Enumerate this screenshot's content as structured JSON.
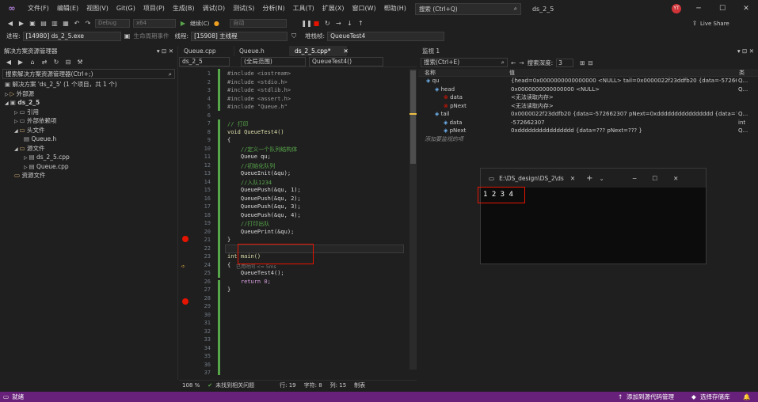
{
  "menu": [
    "文件(F)",
    "编辑(E)",
    "视图(V)",
    "Git(G)",
    "项目(P)",
    "生成(B)",
    "调试(D)",
    "测试(S)",
    "分析(N)",
    "工具(T)",
    "扩展(X)",
    "窗口(W)",
    "帮助(H)"
  ],
  "search": {
    "placeholder": "搜索 (Ctrl+Q)"
  },
  "project_title": "ds_2_5",
  "avatar": "YT",
  "live_share": "Live Share",
  "toolbar1": {
    "config": "Debug",
    "platform": "x64",
    "continue": "继续(C)",
    "frame": "自动"
  },
  "toolbar2": {
    "process_label": "进程:",
    "process": "[14980] ds_2_5.exe",
    "lifecycle": "生命周期事件",
    "thread_label": "线程:",
    "thread": "[15908] 主线程",
    "stack_label": "堆栈帧:",
    "stack": "QueueTest4"
  },
  "solution": {
    "title": "解决方案资源管理器",
    "search": "搜索解决方案资源管理器(Ctrl+;)",
    "items": [
      {
        "t": "解决方案 'ds_2_5' (1 个项目，共 1 个)",
        "lvl": 0
      },
      {
        "t": "外部源",
        "lvl": 0
      },
      {
        "t": "ds_2_5",
        "lvl": 0
      },
      {
        "t": "引用",
        "lvl": 1
      },
      {
        "t": "外部依赖项",
        "lvl": 1
      },
      {
        "t": "头文件",
        "lvl": 1
      },
      {
        "t": "Queue.h",
        "lvl": 2
      },
      {
        "t": "源文件",
        "lvl": 1
      },
      {
        "t": "ds_2_5.cpp",
        "lvl": 2
      },
      {
        "t": "Queue.cpp",
        "lvl": 2
      },
      {
        "t": "资源文件",
        "lvl": 1
      }
    ]
  },
  "editor": {
    "tabs": [
      "Queue.cpp",
      "Queue.h",
      "ds_2_5.cpp*"
    ],
    "nav_project": "ds_2_5",
    "nav_scope": "(全局范围)",
    "nav_func": "QueueTest4()",
    "lines": [
      {
        "n": "1",
        "c": "#include <iostream>"
      },
      {
        "n": "2",
        "c": "#include <stdio.h>"
      },
      {
        "n": "3",
        "c": "#include <stdlib.h>"
      },
      {
        "n": "4",
        "c": "#include <assert.h>"
      },
      {
        "n": "5",
        "c": "#include \"Queue.h\""
      },
      {
        "n": "6",
        "c": ""
      },
      {
        "n": "7",
        "c": "// 打印"
      },
      {
        "n": "8",
        "c": "void QueueTest4()"
      },
      {
        "n": "9",
        "c": "{"
      },
      {
        "n": "10",
        "c": "    //定义一个队列结构体"
      },
      {
        "n": "11",
        "c": "    Queue qu;"
      },
      {
        "n": "12",
        "c": "    //初始化队列"
      },
      {
        "n": "13",
        "c": "    QueueInit(&qu);"
      },
      {
        "n": "14",
        "c": "    //入队1234"
      },
      {
        "n": "15",
        "c": "    QueuePush(&qu, 1);"
      },
      {
        "n": "16",
        "c": "    QueuePush(&qu, 2);"
      },
      {
        "n": "17",
        "c": "    QueuePush(&qu, 3);"
      },
      {
        "n": "18",
        "c": "    QueuePush(&qu, 4);"
      },
      {
        "n": "19",
        "c": "    //打印出队"
      },
      {
        "n": "20",
        "c": "    QueuePrint(&qu);"
      },
      {
        "n": "21",
        "c": "}"
      },
      {
        "n": "22",
        "c": ""
      },
      {
        "n": "23",
        "c": "int main()"
      },
      {
        "n": "24",
        "c": "{"
      },
      {
        "n": "25",
        "c": "    QueueTest4();"
      },
      {
        "n": "26",
        "c": "    return 0;"
      },
      {
        "n": "27",
        "c": "}"
      },
      {
        "n": "28",
        "c": ""
      },
      {
        "n": "29",
        "c": ""
      },
      {
        "n": "30",
        "c": ""
      },
      {
        "n": "31",
        "c": ""
      },
      {
        "n": "32",
        "c": ""
      },
      {
        "n": "33",
        "c": ""
      },
      {
        "n": "34",
        "c": ""
      },
      {
        "n": "35",
        "c": ""
      },
      {
        "n": "36",
        "c": ""
      },
      {
        "n": "37",
        "c": ""
      }
    ],
    "elapsed": "已用时间 <= 5ms"
  },
  "editor_status": {
    "zoom": "108 %",
    "issues": "未找到相关问题",
    "row": "行: 19",
    "col": "字符: 8",
    "colnum": "列: 15",
    "mode": "制表"
  },
  "watch": {
    "title": "监视 1",
    "search": "搜索(Ctrl+E)",
    "depth_label": "搜索深度:",
    "depth": "3",
    "col_name": "名称",
    "col_value": "值",
    "col_type": "类",
    "rows": [
      {
        "name": "qu",
        "value": "{head=0x0000000000000000 <NULL> tail=0x0000022f23ddfb20 {data=-572662307 ...",
        "type": "Q...",
        "lvl": 0
      },
      {
        "name": "head",
        "value": "0x0000000000000000 <NULL>",
        "type": "Q...",
        "lvl": 1
      },
      {
        "name": "data",
        "value": "<无法读取内存>",
        "type": "",
        "lvl": 2
      },
      {
        "name": "pNext",
        "value": "<无法读取内存>",
        "type": "",
        "lvl": 2
      },
      {
        "name": "tail",
        "value": "0x0000022f23ddfb20 {data=-572662307 pNext=0xdddddddddddddddd {data=??? ...",
        "type": "Q...",
        "lvl": 1
      },
      {
        "name": "data",
        "value": "-572662307",
        "type": "int",
        "lvl": 2
      },
      {
        "name": "pNext",
        "value": "0xdddddddddddddddd {data=??? pNext=??? }",
        "type": "Q...",
        "lvl": 2
      }
    ],
    "add_item": "添加要监视的项"
  },
  "console": {
    "title": "E:\\DS_design\\DS_2\\ds",
    "output": "1 2 3 4"
  },
  "status": {
    "ready": "就绪",
    "add_source": "添加到源代码管理",
    "repo": "选择存储库"
  }
}
